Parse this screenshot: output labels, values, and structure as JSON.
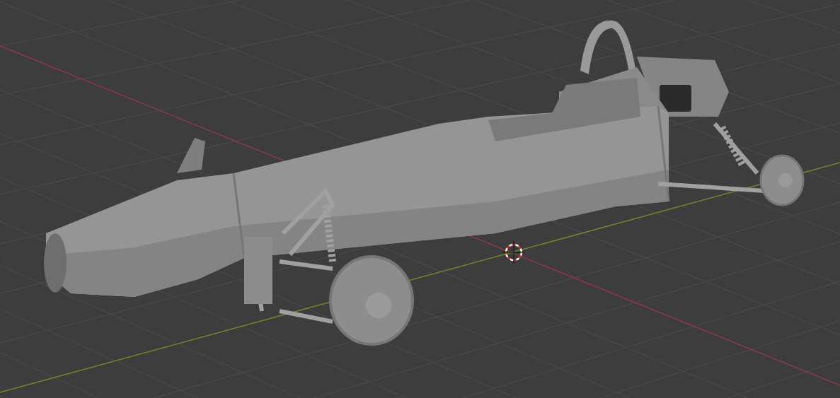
{
  "viewport": {
    "show_grid": true,
    "show_axes": true,
    "show_cursor": true,
    "object": {
      "kind": "race-car"
    }
  }
}
